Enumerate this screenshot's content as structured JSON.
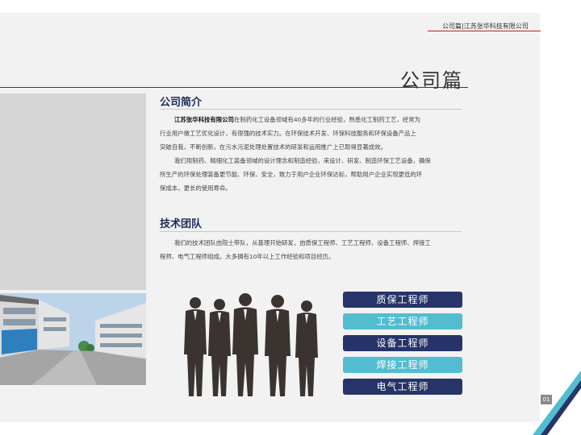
{
  "header": {
    "breadcrumb": "公司篇|江苏张华科技有限公司"
  },
  "section_title": "公司篇",
  "intro": {
    "heading": "公司简介",
    "company_name": "江苏张华科技有限公司",
    "p1_lines": [
      "在制药化工设备领域有40多年的行业经验，熟悉化工制药工艺，经常为",
      "行业用户做工艺优化设计，有很强的技术实力。在环保技术开发、环保科技服务和环保设备产品上",
      "突破自我，不断创新，在污水污泥处理处置技术的研发和运用推广上已取得显著成效。"
    ],
    "p2_lines": [
      "我们用制药、精细化工装备领域的设计理念和制造经验，来设计、研发、制造环保工艺设备，确保",
      "所生产的环保处理装备更节能、环保、安全，致力于用户企业环保达标，帮助用户企业实现更低的环",
      "保成本，更长的使用寿命。"
    ]
  },
  "team": {
    "heading": "技术团队",
    "lines": [
      "我们的技术团队由院士带队，从基理开始研发，由质保工程师、工艺工程师、设备工程师、焊接工",
      "程师、电气工程师组成。大多拥有10年以上工作经验和项目经历。"
    ],
    "roles": [
      "质保工程师",
      "工艺工程师",
      "设备工程师",
      "焊接工程师",
      "电气工程师"
    ]
  },
  "page_number": "01",
  "colors": {
    "navy": "#26346a",
    "teal": "#52bdd0",
    "accent_red": "#c0202a"
  }
}
